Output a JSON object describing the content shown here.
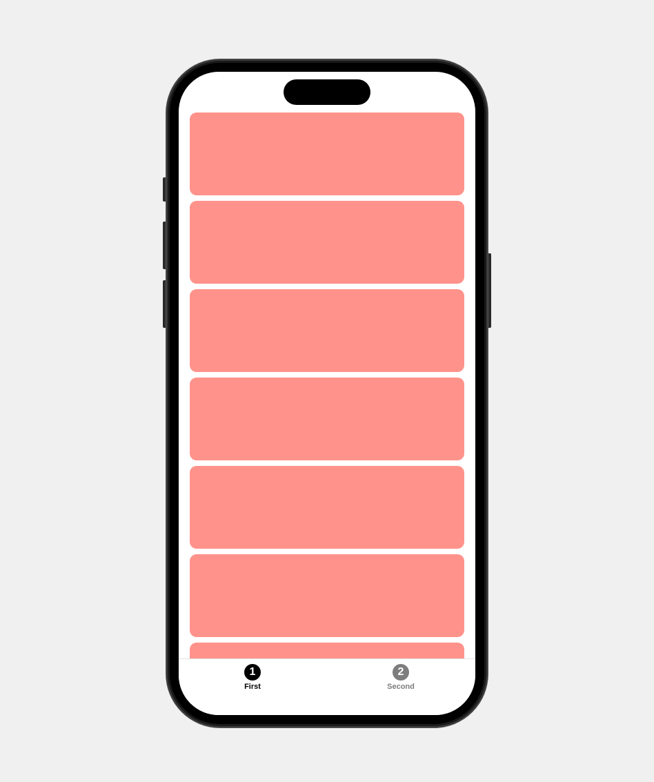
{
  "tab_bar": {
    "tabs": [
      {
        "number": "1",
        "label": "First",
        "selected": true,
        "color": "#000000"
      },
      {
        "number": "2",
        "label": "Second",
        "selected": false,
        "color": "#7d7d7d"
      }
    ]
  },
  "content": {
    "card_color": "#ff938b",
    "card_count": 7
  }
}
